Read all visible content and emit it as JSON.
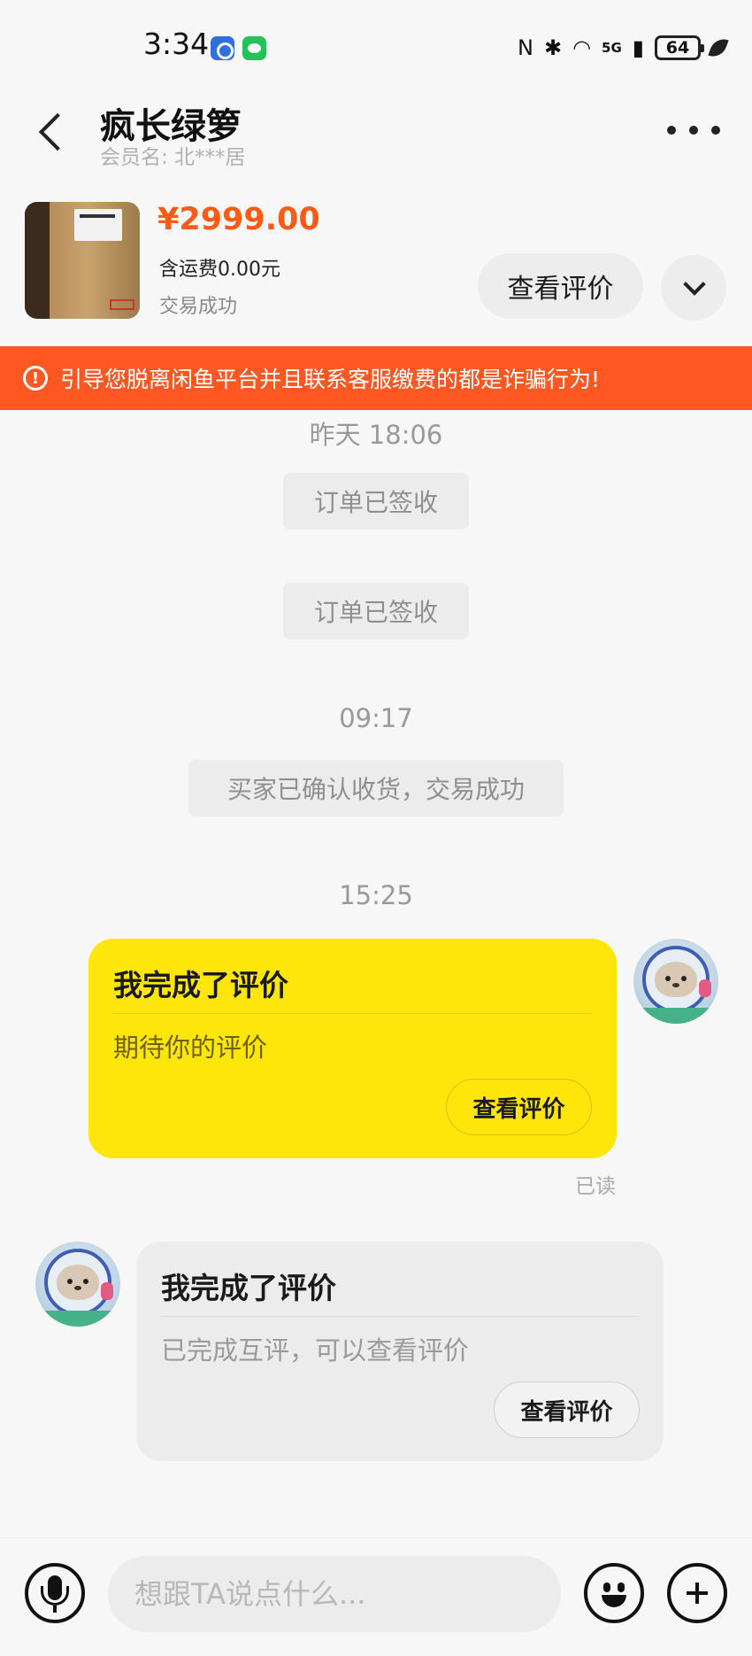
{
  "status_bar": {
    "time": "3:34",
    "network": "5G",
    "battery": "64",
    "icons": [
      "nfc-icon",
      "bluetooth-icon",
      "wifi-icon",
      "signal-icon",
      "battery-icon",
      "leaf-icon"
    ]
  },
  "header": {
    "title": "疯长绿箩",
    "member_label": "会员名: 北***居"
  },
  "product": {
    "price": "¥2999.00",
    "shipping": "含运费0.00元",
    "status": "交易成功",
    "view_review_label": "查看评价"
  },
  "warning": {
    "text": "引导您脱离闲鱼平台并且联系客服缴费的都是诈骗行为!",
    "color": "#ff5722"
  },
  "chat": {
    "time1": "昨天 18:06",
    "sys1": "订单已签收",
    "sys2": "订单已签收",
    "time2": "09:17",
    "sys3": "买家已确认收货，交易成功",
    "time3": "15:25",
    "my_card": {
      "title": "我完成了评价",
      "body": "期待你的评价",
      "button": "查看评价"
    },
    "read_status": "已读",
    "their_card": {
      "title": "我完成了评价",
      "body": "已完成互评，可以查看评价",
      "button": "查看评价"
    }
  },
  "input_bar": {
    "placeholder": "想跟TA说点什么..."
  },
  "colors": {
    "accent_price": "#ff5a16",
    "my_bubble": "#ffe60a",
    "their_bubble": "#ececec"
  }
}
